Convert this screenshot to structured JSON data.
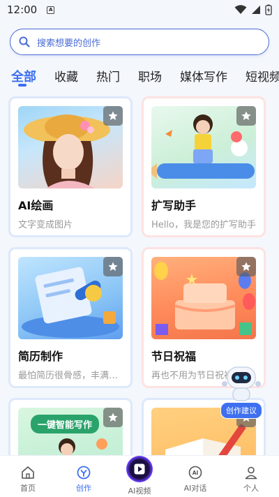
{
  "status": {
    "time": "12:00"
  },
  "search": {
    "placeholder": "搜索想要的创作"
  },
  "tabs": [
    "全部",
    "收藏",
    "热门",
    "职场",
    "媒体写作",
    "短视频"
  ],
  "cards": [
    {
      "title": "AI绘画",
      "desc": "文字变成图片"
    },
    {
      "title": "扩写助手",
      "desc": "Hello，我是您的扩写助手"
    },
    {
      "title": "简历制作",
      "desc": "最怕简历很骨感，丰满履历"
    },
    {
      "title": "节日祝福",
      "desc": "再也不用为节日祝福发愁"
    },
    {
      "title": "",
      "desc": "",
      "banner": "一键智能写作"
    },
    {
      "title": "",
      "desc": ""
    }
  ],
  "assistant": {
    "label": "创作建议"
  },
  "nav": [
    {
      "label": "首页"
    },
    {
      "label": "创作"
    },
    {
      "label": "AI视频"
    },
    {
      "label": "AI对话"
    },
    {
      "label": "个人"
    }
  ],
  "colors": {
    "accent": "#3d6ff0"
  }
}
